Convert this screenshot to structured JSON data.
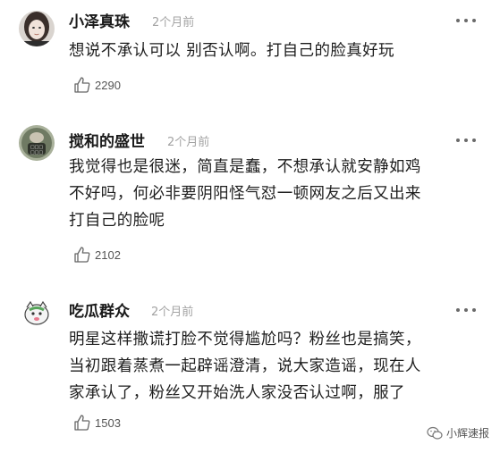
{
  "comments": [
    {
      "username": "小泽真珠",
      "time": "2个月前",
      "lines": [
        "想说不承认可以 别否认啊。打自己的脸真好玩"
      ],
      "likes": "2290"
    },
    {
      "username": "搅和的盛世",
      "time": "2个月前",
      "lines": [
        "我觉得也是很迷，简直是蠢，不想承认就安静如鸡",
        "不好吗，何必非要阴阳怪气怼一顿网友之后又出来",
        "打自己的脸呢"
      ],
      "likes": "2102"
    },
    {
      "username": "吃瓜群众",
      "time": "2个月前",
      "lines": [
        "明星这样撒谎打脸不觉得尴尬吗？粉丝也是搞笑，",
        "当初跟着蒸煮一起辟谣澄清，说大家造谣，现在人",
        "家承认了，粉丝又开始洗人家没否认过啊，服了"
      ],
      "likes": "1503"
    }
  ],
  "watermark": "小辉速报",
  "icons": {
    "like": "thumbs-up-icon",
    "more": "more-dots-icon",
    "watermark": "wechat-icon"
  }
}
